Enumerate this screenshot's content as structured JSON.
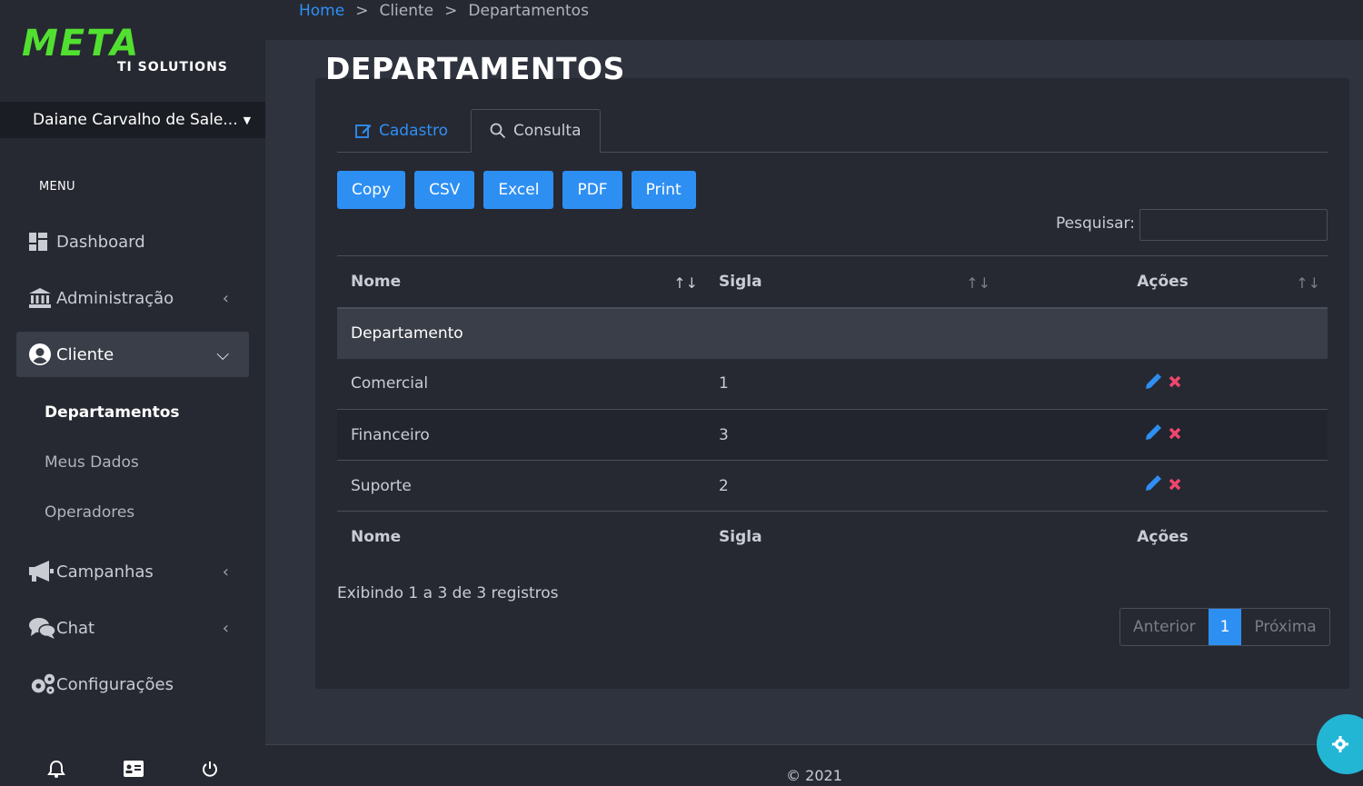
{
  "brand": {
    "name": "META",
    "subtitle": "TI SOLUTIONS",
    "color": "#52e030"
  },
  "user": {
    "name": "Daiane Carvalho de Sale..."
  },
  "sidebar": {
    "menu_title": "MENU",
    "items": [
      {
        "label": "Dashboard",
        "icon": "dashboard-icon"
      },
      {
        "label": "Administração",
        "icon": "bank-icon"
      },
      {
        "label": "Cliente",
        "icon": "user-circle-icon",
        "active": true
      },
      {
        "label": "Campanhas",
        "icon": "megaphone-icon"
      },
      {
        "label": "Chat",
        "icon": "comments-icon"
      },
      {
        "label": "Configurações",
        "icon": "gears-icon"
      }
    ],
    "subitems": [
      {
        "label": "Departamentos",
        "active": true
      },
      {
        "label": "Meus Dados"
      },
      {
        "label": "Operadores"
      }
    ]
  },
  "breadcrumb": {
    "home": "Home",
    "level1": "Cliente",
    "level2": "Departamentos"
  },
  "page": {
    "title": "DEPARTAMENTOS"
  },
  "tabs": {
    "cadastro": "Cadastro",
    "consulta": "Consulta"
  },
  "toolbar": {
    "copy": "Copy",
    "csv": "CSV",
    "excel": "Excel",
    "pdf": "PDF",
    "print": "Print"
  },
  "search": {
    "label": "Pesquisar:",
    "value": ""
  },
  "table": {
    "headers": {
      "nome": "Nome",
      "sigla": "Sigla",
      "acoes": "Ações"
    },
    "group": "Departamento",
    "rows": [
      {
        "nome": "Comercial",
        "sigla": "1"
      },
      {
        "nome": "Financeiro",
        "sigla": "3"
      },
      {
        "nome": "Suporte",
        "sigla": "2"
      }
    ]
  },
  "info": "Exibindo 1 a 3 de 3 registros",
  "pager": {
    "prev": "Anterior",
    "current": "1",
    "next": "Próxima"
  },
  "footer": "© 2021",
  "colors": {
    "accent": "#2e8ff3",
    "delete": "#f0466e",
    "fab": "#22b6d4"
  }
}
